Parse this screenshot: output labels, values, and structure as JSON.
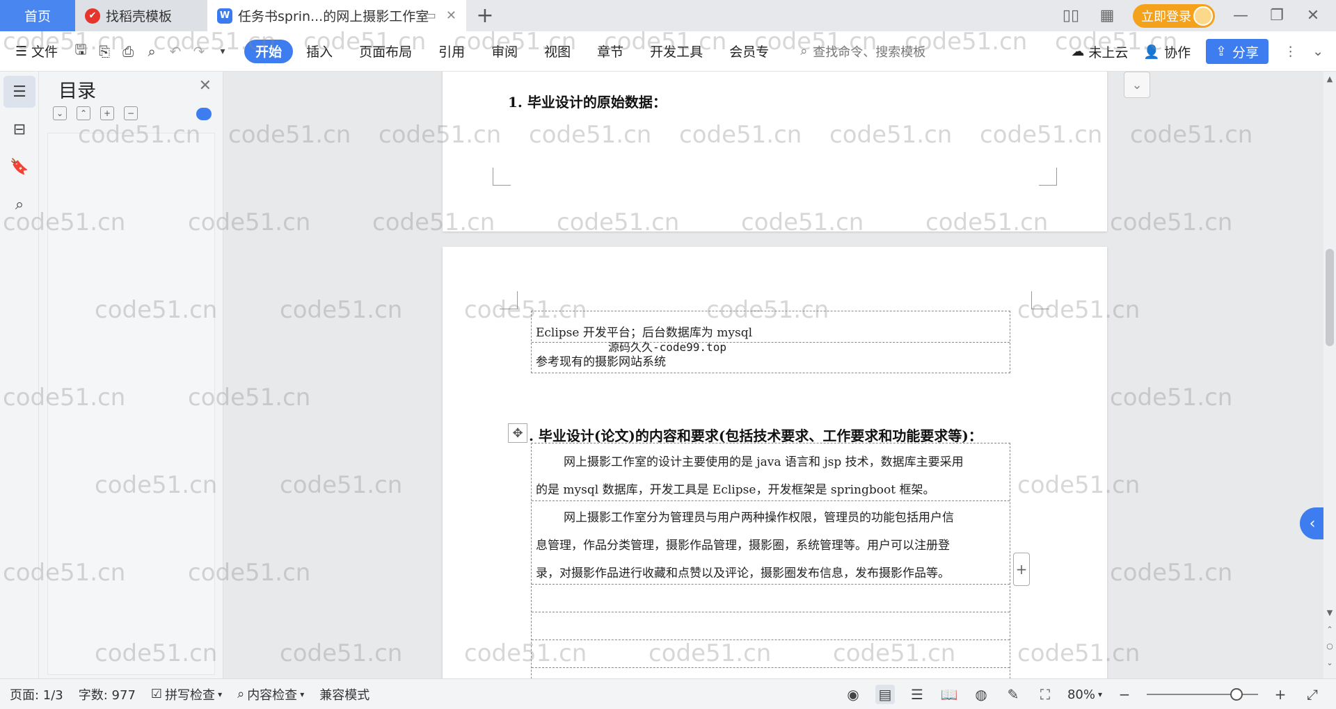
{
  "tabs": {
    "home": "首页",
    "templates": "找稻壳模板",
    "document": "任务书sprin...的网上摄影工作室",
    "document_logo": "W"
  },
  "window": {
    "login": "立即登录"
  },
  "menu": {
    "file": "文件",
    "tabs": [
      "开始",
      "插入",
      "页面布局",
      "引用",
      "审阅",
      "视图",
      "章节",
      "开发工具",
      "会员专"
    ],
    "search_placeholder": "查找命令、搜索模板",
    "cloud": "未上云",
    "collab": "协作",
    "share": "分享"
  },
  "toc": {
    "title": "目录"
  },
  "document": {
    "heading1": "1. 毕业设计的原始数据：",
    "table1": {
      "row1": "Eclipse 开发平台；后台数据库为 mysql",
      "overlay": "源码久久-code99.top",
      "row2": "参考现有的摄影网站系统"
    },
    "heading2": ". 毕业设计(论文)的内容和要求(包括技术要求、工作要求和功能要求等)：",
    "paragraphs": [
      "网上摄影工作室的设计主要使用的是 java 语言和 jsp 技术，数据库主要采用",
      "的是 mysql 数据库，开发工具是 Eclipse，开发框架是 springboot 框架。",
      "网上摄影工作室分为管理员与用户两种操作权限，管理员的功能包括用户信",
      "息管理，作品分类管理，摄影作品管理，摄影圈，系统管理等。用户可以注册登",
      "录，对摄影作品进行收藏和点赞以及评论，摄影圈发布信息，发布摄影作品等。"
    ]
  },
  "watermark": "code51.cn",
  "status": {
    "page": "页面: 1/3",
    "words": "字数: 977",
    "spell": "拼写检查",
    "content_check": "内容检查",
    "compat": "兼容模式",
    "zoom": "80%"
  },
  "colors": {
    "accent": "#3d7df0",
    "login": "#f4a21c",
    "home_tab": "#4a86f0"
  }
}
